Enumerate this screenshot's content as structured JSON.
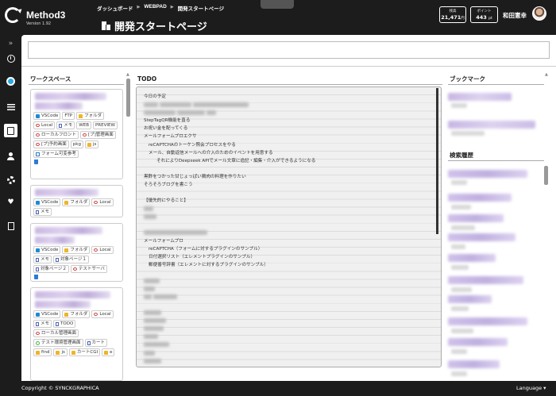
{
  "app": {
    "name": "Method3",
    "version": "Version 1.92"
  },
  "breadcrumb": [
    "ダッシュボード",
    "WEBPAD",
    "開発スタートページ"
  ],
  "page_title": "開発スタートページ",
  "stats": {
    "points_label": "残高",
    "points_value": "21,471",
    "points_unit": "円",
    "bonus_label": "ポイント",
    "bonus_value": "443",
    "bonus_unit": "pt"
  },
  "user": {
    "name": "和田憲幸"
  },
  "sidebar": {
    "items": [
      "collapse-icon",
      "clock-icon",
      "dashboard-icon",
      "list-icon",
      "memo-icon",
      "user-icon",
      "gear-icon",
      "heart-icon",
      "book-icon"
    ]
  },
  "search": {
    "placeholder": ""
  },
  "panels": {
    "workspace": "ワークスペース",
    "todo": "TODO",
    "bookmark": "ブックマーク",
    "history": "検索履歴"
  },
  "workspaces": [
    {
      "chips": [
        "VSCode",
        "FTP",
        "フォルダ",
        "Local",
        "メモ",
        "WEB",
        "PREVIEW",
        "ローカルフロント",
        "[プ]管理画面",
        "[プ]予約画面",
        "pkg",
        "js",
        "フォーム可変参考"
      ]
    },
    {
      "chips": [
        "VSCode",
        "フォルダ",
        "Local",
        "メモ"
      ]
    },
    {
      "chips": [
        "VSCode",
        "フォルダ",
        "Local",
        "メモ",
        "対象ページ１",
        "対象ページ２",
        "テストサーバ"
      ]
    },
    {
      "chips": [
        "VSCode",
        "フォルダ",
        "Local",
        "メモ",
        "TODO",
        "ローカル管理画面",
        "テスト環境管理画面",
        "カート",
        "find",
        "js",
        "カートCGI",
        "e"
      ]
    }
  ],
  "todo": {
    "lines": [
      "今日の予定",
      "",
      "",
      "StepTagQR機能を直る",
      "お祝い金を配ってくる",
      "メールフォームプロエクサ",
      "reCAPTCHAのトーケン照会プロセスをやる",
      "メール、自動返信メールへの介入のためのイベントを用意する",
      "それによりDeepseek APIでメール文章に追記・編集・介入ができるようになる",
      "",
      "黒酢をつかった甘じょっぱい鶏肉の料理を作りたい",
      "そろそろブログを書こう",
      "",
      "【優先的にやること】",
      "",
      "",
      "",
      "",
      "メールフォームプロ",
      "reCAPTCHA（フォームに対するプラグインのサンプル）",
      "日付選択リスト（エレメントプラグインのサンプル）",
      "郵便番号辞書（エレメントに対するプラグインのサンプル）"
    ]
  },
  "footer": {
    "copyright": "Copyright © SYNCKGRAPHICA",
    "language": "Language ▾"
  },
  "colors": {
    "background": "#1c1c1c",
    "accent": "#29a9e0",
    "blur_purple": "#c9b8e2"
  }
}
